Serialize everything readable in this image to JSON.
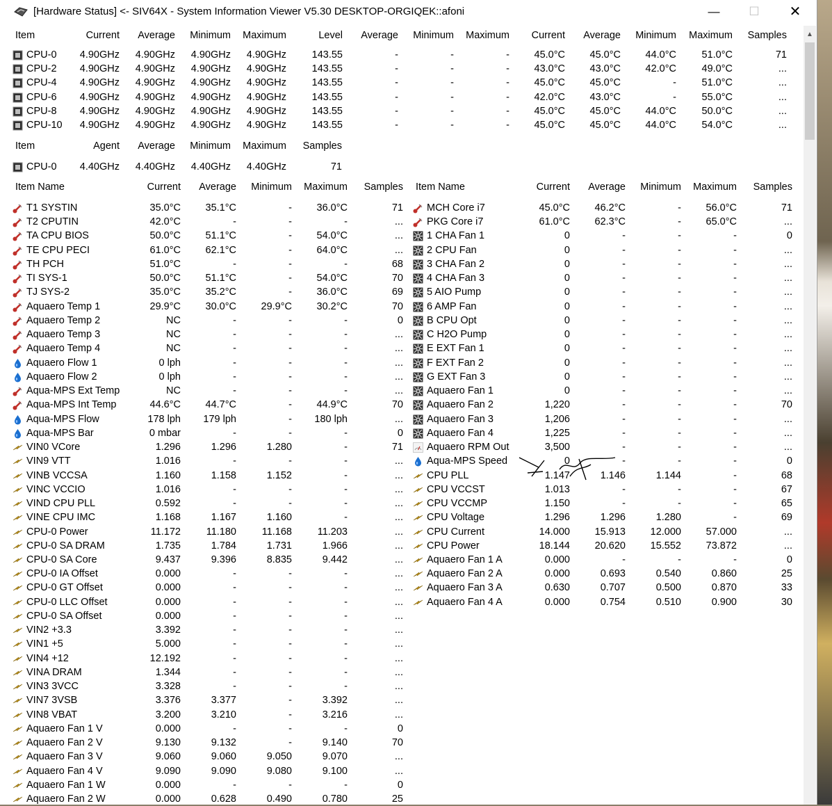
{
  "window": {
    "title": "[Hardware Status] <- SIV64X - System Information Viewer V5.30 DESKTOP-ORGIQEK::afoni",
    "controls": {
      "minimize": "—",
      "maximize": "☐",
      "close": "✕"
    }
  },
  "clock_table": {
    "headers": [
      "Item",
      "Current",
      "Average",
      "Minimum",
      "Maximum",
      "Level",
      "Average",
      "Minimum",
      "Maximum",
      "Current",
      "Average",
      "Minimum",
      "Maximum",
      "Samples"
    ],
    "rows": [
      [
        "CPU-0",
        "4.90GHz",
        "4.90GHz",
        "4.90GHz",
        "4.90GHz",
        "143.55",
        "-",
        "-",
        "-",
        "45.0°C",
        "45.0°C",
        "44.0°C",
        "51.0°C",
        "71"
      ],
      [
        "CPU-2",
        "4.90GHz",
        "4.90GHz",
        "4.90GHz",
        "4.90GHz",
        "143.55",
        "-",
        "-",
        "-",
        "43.0°C",
        "43.0°C",
        "42.0°C",
        "49.0°C",
        "..."
      ],
      [
        "CPU-4",
        "4.90GHz",
        "4.90GHz",
        "4.90GHz",
        "4.90GHz",
        "143.55",
        "-",
        "-",
        "-",
        "45.0°C",
        "45.0°C",
        "-",
        "51.0°C",
        "..."
      ],
      [
        "CPU-6",
        "4.90GHz",
        "4.90GHz",
        "4.90GHz",
        "4.90GHz",
        "143.55",
        "-",
        "-",
        "-",
        "42.0°C",
        "43.0°C",
        "-",
        "55.0°C",
        "..."
      ],
      [
        "CPU-8",
        "4.90GHz",
        "4.90GHz",
        "4.90GHz",
        "4.90GHz",
        "143.55",
        "-",
        "-",
        "-",
        "45.0°C",
        "45.0°C",
        "44.0°C",
        "50.0°C",
        "..."
      ],
      [
        "CPU-10",
        "4.90GHz",
        "4.90GHz",
        "4.90GHz",
        "4.90GHz",
        "143.55",
        "-",
        "-",
        "-",
        "45.0°C",
        "45.0°C",
        "44.0°C",
        "54.0°C",
        "..."
      ]
    ]
  },
  "agent_table": {
    "headers": [
      "Item",
      "Agent",
      "Average",
      "Minimum",
      "Maximum",
      "Samples"
    ],
    "rows": [
      [
        "CPU-0",
        "4.40GHz",
        "4.40GHz",
        "4.40GHz",
        "4.40GHz",
        "71"
      ]
    ]
  },
  "sensor_headers": [
    "Item Name",
    "Current",
    "Average",
    "Minimum",
    "Maximum",
    "Samples"
  ],
  "left_sensors": [
    {
      "icon": "thermometer",
      "cells": [
        "T1 SYSTIN",
        "35.0°C",
        "35.1°C",
        "-",
        "36.0°C",
        "71"
      ]
    },
    {
      "icon": "thermometer",
      "cells": [
        "T2 CPUTIN",
        "42.0°C",
        "-",
        "-",
        "-",
        "..."
      ]
    },
    {
      "icon": "thermometer",
      "cells": [
        "TA CPU BIOS",
        "50.0°C",
        "51.1°C",
        "-",
        "54.0°C",
        "..."
      ]
    },
    {
      "icon": "thermometer",
      "cells": [
        "TE CPU PECI",
        "61.0°C",
        "62.1°C",
        "-",
        "64.0°C",
        "..."
      ]
    },
    {
      "icon": "thermometer",
      "cells": [
        "TH PCH",
        "51.0°C",
        "-",
        "-",
        "-",
        "68"
      ]
    },
    {
      "icon": "thermometer",
      "cells": [
        "TI SYS-1",
        "50.0°C",
        "51.1°C",
        "-",
        "54.0°C",
        "70"
      ]
    },
    {
      "icon": "thermometer",
      "cells": [
        "TJ SYS-2",
        "35.0°C",
        "35.2°C",
        "-",
        "36.0°C",
        "69"
      ]
    },
    {
      "icon": "thermometer",
      "cells": [
        "Aquaero Temp 1",
        "29.9°C",
        "30.0°C",
        "29.9°C",
        "30.2°C",
        "70"
      ]
    },
    {
      "icon": "thermometer",
      "cells": [
        "Aquaero Temp 2",
        "NC",
        "-",
        "-",
        "-",
        "0"
      ]
    },
    {
      "icon": "thermometer",
      "cells": [
        "Aquaero Temp 3",
        "NC",
        "-",
        "-",
        "-",
        "..."
      ]
    },
    {
      "icon": "thermometer",
      "cells": [
        "Aquaero Temp 4",
        "NC",
        "-",
        "-",
        "-",
        "..."
      ]
    },
    {
      "icon": "drop",
      "cells": [
        "Aquaero Flow 1",
        "0 lph",
        "-",
        "-",
        "-",
        "..."
      ]
    },
    {
      "icon": "drop",
      "cells": [
        "Aquaero Flow 2",
        "0 lph",
        "-",
        "-",
        "-",
        "..."
      ]
    },
    {
      "icon": "thermometer",
      "cells": [
        "Aqua-MPS Ext Temp",
        "NC",
        "-",
        "-",
        "-",
        "..."
      ]
    },
    {
      "icon": "thermometer",
      "cells": [
        "Aqua-MPS Int Temp",
        "44.6°C",
        "44.7°C",
        "-",
        "44.9°C",
        "70"
      ]
    },
    {
      "icon": "drop",
      "cells": [
        "Aqua-MPS Flow",
        "178 lph",
        "179 lph",
        "-",
        "180 lph",
        "..."
      ]
    },
    {
      "icon": "drop",
      "cells": [
        "Aqua-MPS Bar",
        "0 mbar",
        "-",
        "-",
        "-",
        "0"
      ]
    },
    {
      "icon": "voltage",
      "cells": [
        "VIN0 VCore",
        "1.296",
        "1.296",
        "1.280",
        "-",
        "71"
      ]
    },
    {
      "icon": "voltage",
      "cells": [
        "VIN9 VTT",
        "1.016",
        "-",
        "-",
        "-",
        "..."
      ]
    },
    {
      "icon": "voltage",
      "cells": [
        "VINB VCCSA",
        "1.160",
        "1.158",
        "1.152",
        "-",
        "..."
      ]
    },
    {
      "icon": "voltage",
      "cells": [
        "VINC VCCIO",
        "1.016",
        "-",
        "-",
        "-",
        "..."
      ]
    },
    {
      "icon": "voltage",
      "cells": [
        "VIND CPU PLL",
        "0.592",
        "-",
        "-",
        "-",
        "..."
      ]
    },
    {
      "icon": "voltage",
      "cells": [
        "VINE CPU IMC",
        "1.168",
        "1.167",
        "1.160",
        "-",
        "..."
      ]
    },
    {
      "icon": "voltage",
      "cells": [
        "CPU-0 Power",
        "11.172",
        "11.180",
        "11.168",
        "11.203",
        "..."
      ]
    },
    {
      "icon": "voltage",
      "cells": [
        "CPU-0 SA DRAM",
        "1.735",
        "1.784",
        "1.731",
        "1.966",
        "..."
      ]
    },
    {
      "icon": "voltage",
      "cells": [
        "CPU-0 SA Core",
        "9.437",
        "9.396",
        "8.835",
        "9.442",
        "..."
      ]
    },
    {
      "icon": "voltage",
      "cells": [
        "CPU-0 IA Offset",
        "0.000",
        "-",
        "-",
        "-",
        "..."
      ]
    },
    {
      "icon": "voltage",
      "cells": [
        "CPU-0 GT Offset",
        "0.000",
        "-",
        "-",
        "-",
        "..."
      ]
    },
    {
      "icon": "voltage",
      "cells": [
        "CPU-0 LLC Offset",
        "0.000",
        "-",
        "-",
        "-",
        "..."
      ]
    },
    {
      "icon": "voltage",
      "cells": [
        "CPU-0 SA Offset",
        "0.000",
        "-",
        "-",
        "-",
        "..."
      ]
    },
    {
      "icon": "voltage",
      "cells": [
        "VIN2 +3.3",
        "3.392",
        "-",
        "-",
        "-",
        "..."
      ]
    },
    {
      "icon": "voltage",
      "cells": [
        "VIN1 +5",
        "5.000",
        "-",
        "-",
        "-",
        "..."
      ]
    },
    {
      "icon": "voltage",
      "cells": [
        "VIN4 +12",
        "12.192",
        "-",
        "-",
        "-",
        "..."
      ]
    },
    {
      "icon": "voltage",
      "cells": [
        "VINA DRAM",
        "1.344",
        "-",
        "-",
        "-",
        "..."
      ]
    },
    {
      "icon": "voltage",
      "cells": [
        "VIN3 3VCC",
        "3.328",
        "-",
        "-",
        "-",
        "..."
      ]
    },
    {
      "icon": "voltage",
      "cells": [
        "VIN7 3VSB",
        "3.376",
        "3.377",
        "-",
        "3.392",
        "..."
      ]
    },
    {
      "icon": "voltage",
      "cells": [
        "VIN8 VBAT",
        "3.200",
        "3.210",
        "-",
        "3.216",
        "..."
      ]
    },
    {
      "icon": "voltage",
      "cells": [
        "Aquaero Fan 1 V",
        "0.000",
        "-",
        "-",
        "-",
        "0"
      ]
    },
    {
      "icon": "voltage",
      "cells": [
        "Aquaero Fan 2 V",
        "9.130",
        "9.132",
        "-",
        "9.140",
        "70"
      ]
    },
    {
      "icon": "voltage",
      "cells": [
        "Aquaero Fan 3 V",
        "9.060",
        "9.060",
        "9.050",
        "9.070",
        "..."
      ]
    },
    {
      "icon": "voltage",
      "cells": [
        "Aquaero Fan 4 V",
        "9.090",
        "9.090",
        "9.080",
        "9.100",
        "..."
      ]
    },
    {
      "icon": "voltage",
      "cells": [
        "Aquaero Fan 1 W",
        "0.000",
        "-",
        "-",
        "-",
        "0"
      ]
    },
    {
      "icon": "voltage",
      "cells": [
        "Aquaero Fan 2 W",
        "0.000",
        "0.628",
        "0.490",
        "0.780",
        "25"
      ]
    }
  ],
  "right_sensors": [
    {
      "icon": "thermometer",
      "cells": [
        "MCH Core i7",
        "45.0°C",
        "46.2°C",
        "-",
        "56.0°C",
        "71"
      ]
    },
    {
      "icon": "thermometer",
      "cells": [
        "PKG Core i7",
        "61.0°C",
        "62.3°C",
        "-",
        "65.0°C",
        "..."
      ]
    },
    {
      "icon": "fan",
      "cells": [
        "1 CHA Fan 1",
        "0",
        "-",
        "-",
        "-",
        "0"
      ]
    },
    {
      "icon": "fan",
      "cells": [
        "2 CPU Fan",
        "0",
        "-",
        "-",
        "-",
        "..."
      ]
    },
    {
      "icon": "fan",
      "cells": [
        "3 CHA Fan 2",
        "0",
        "-",
        "-",
        "-",
        "..."
      ]
    },
    {
      "icon": "fan",
      "cells": [
        "4 CHA Fan 3",
        "0",
        "-",
        "-",
        "-",
        "..."
      ]
    },
    {
      "icon": "fan",
      "cells": [
        "5 AIO Pump",
        "0",
        "-",
        "-",
        "-",
        "..."
      ]
    },
    {
      "icon": "fan",
      "cells": [
        "6 AMP Fan",
        "0",
        "-",
        "-",
        "-",
        "..."
      ]
    },
    {
      "icon": "fan",
      "cells": [
        "B CPU Opt",
        "0",
        "-",
        "-",
        "-",
        "..."
      ]
    },
    {
      "icon": "fan",
      "cells": [
        "C H2O Pump",
        "0",
        "-",
        "-",
        "-",
        "..."
      ]
    },
    {
      "icon": "fan",
      "cells": [
        "E EXT Fan 1",
        "0",
        "-",
        "-",
        "-",
        "..."
      ]
    },
    {
      "icon": "fan",
      "cells": [
        "F EXT Fan 2",
        "0",
        "-",
        "-",
        "-",
        "..."
      ]
    },
    {
      "icon": "fan",
      "cells": [
        "G EXT Fan 3",
        "0",
        "-",
        "-",
        "-",
        "..."
      ]
    },
    {
      "icon": "fan",
      "cells": [
        "Aquaero Fan 1",
        "0",
        "-",
        "-",
        "-",
        "..."
      ]
    },
    {
      "icon": "fan",
      "cells": [
        "Aquaero Fan 2",
        "1,220",
        "-",
        "-",
        "-",
        "70"
      ]
    },
    {
      "icon": "fan",
      "cells": [
        "Aquaero Fan 3",
        "1,206",
        "-",
        "-",
        "-",
        "..."
      ]
    },
    {
      "icon": "fan",
      "cells": [
        "Aquaero Fan 4",
        "1,225",
        "-",
        "-",
        "-",
        "..."
      ]
    },
    {
      "icon": "rpm",
      "cells": [
        "Aquaero RPM Out",
        "3,500",
        "-",
        "-",
        "-",
        "..."
      ]
    },
    {
      "icon": "drop",
      "cells": [
        "Aqua-MPS Speed",
        "0",
        "-",
        "-",
        "-",
        "0"
      ]
    },
    {
      "icon": "voltage",
      "cells": [
        "CPU PLL",
        "1.147",
        "1.146",
        "1.144",
        "-",
        "68"
      ]
    },
    {
      "icon": "voltage",
      "cells": [
        "CPU VCCST",
        "1.013",
        "-",
        "-",
        "-",
        "67"
      ]
    },
    {
      "icon": "voltage",
      "cells": [
        "CPU VCCMP",
        "1.150",
        "-",
        "-",
        "-",
        "65"
      ]
    },
    {
      "icon": "voltage",
      "cells": [
        "CPU Voltage",
        "1.296",
        "1.296",
        "1.280",
        "-",
        "69"
      ]
    },
    {
      "icon": "voltage",
      "cells": [
        "CPU Current",
        "14.000",
        "15.913",
        "12.000",
        "57.000",
        "..."
      ]
    },
    {
      "icon": "voltage",
      "cells": [
        "CPU Power",
        "18.144",
        "20.620",
        "15.552",
        "73.872",
        "..."
      ]
    },
    {
      "icon": "voltage",
      "cells": [
        "Aquaero Fan 1 A",
        "0.000",
        "-",
        "-",
        "-",
        "0"
      ]
    },
    {
      "icon": "voltage",
      "cells": [
        "Aquaero Fan 2 A",
        "0.000",
        "0.693",
        "0.540",
        "0.860",
        "25"
      ]
    },
    {
      "icon": "voltage",
      "cells": [
        "Aquaero Fan 3 A",
        "0.630",
        "0.707",
        "0.500",
        "0.870",
        "33"
      ]
    },
    {
      "icon": "voltage",
      "cells": [
        "Aquaero Fan 4 A",
        "0.000",
        "0.754",
        "0.510",
        "0.900",
        "30"
      ]
    }
  ],
  "colors": {
    "thermometer": "#c0302a",
    "drop": "#1a6fd0",
    "voltage": "#d4a21a"
  }
}
